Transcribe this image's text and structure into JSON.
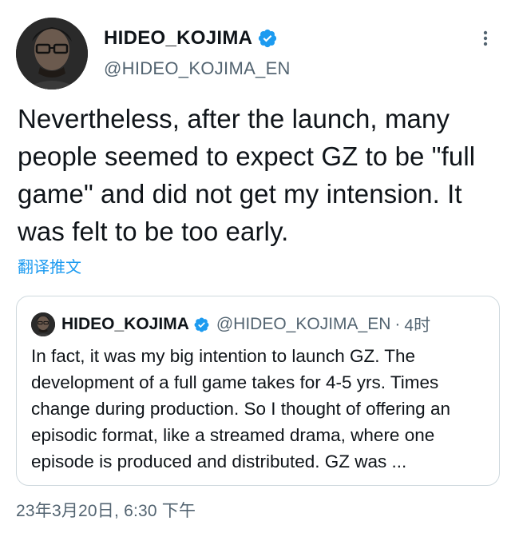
{
  "author": {
    "display_name": "HIDEO_KOJIMA",
    "handle": "@HIDEO_KOJIMA_EN",
    "avatar_icon": "profile-photo",
    "verified_icon": "verified-badge-icon"
  },
  "tweet": {
    "text": "Nevertheless, after the launch, many people seemed to expect GZ to be \"full game\" and did not get my intension. It was felt to be too early.",
    "translate_label": "翻译推文",
    "timestamp": "23年3月20日, 6:30 下午"
  },
  "quoted": {
    "display_name": "HIDEO_KOJIMA",
    "handle": "@HIDEO_KOJIMA_EN",
    "separator": "·",
    "time": "4时",
    "text": "In fact, it was my big intention to launch GZ. The development of a full game takes for 4-5 yrs. Times change during production. So I thought of offering an episodic format, like a streamed drama, where one episode is produced and distributed. GZ was ..."
  },
  "colors": {
    "text": "#0f1419",
    "secondary": "#536471",
    "accent": "#1d9bf0",
    "border": "#cfd9de"
  }
}
